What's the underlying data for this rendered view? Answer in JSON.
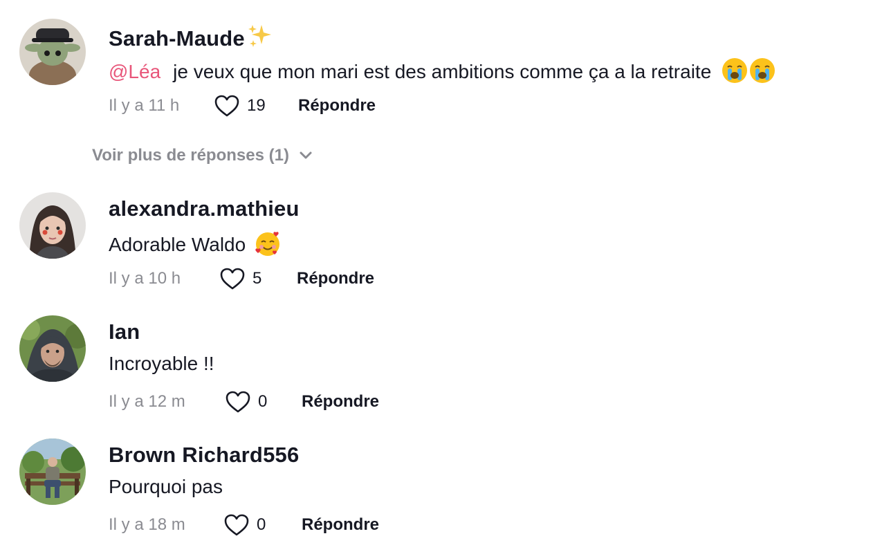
{
  "comments": [
    {
      "username": "Sarah-Maude",
      "username_emoji": "sparkles-emoji",
      "mention": "@Léa",
      "text": "je veux que mon mari est des ambitions comme ça a la retraite",
      "text_emojis": [
        "loudly-crying-face-emoji",
        "loudly-crying-face-emoji"
      ],
      "time": "Il y a 11 h",
      "likes": "19",
      "reply_label": "Répondre"
    },
    {
      "username": "alexandra.mathieu",
      "text": "Adorable Waldo",
      "text_emojis": [
        "smiling-face-with-hearts-emoji"
      ],
      "time": "Il y a 10 h",
      "likes": "5",
      "reply_label": "Répondre"
    },
    {
      "username": "Ian",
      "text": "Incroyable !!",
      "time": "Il y a 12 m",
      "likes": "0",
      "reply_label": "Répondre"
    },
    {
      "username": "Brown Richard556",
      "text": "Pourquoi pas",
      "time": "Il y a 18 m",
      "likes": "0",
      "reply_label": "Répondre"
    }
  ],
  "view_more_replies": "Voir plus de réponses (1)",
  "icons": {
    "like": "heart-outline-icon",
    "expand": "chevron-down-icon"
  },
  "colors": {
    "mention": "#e8567a",
    "secondary_text": "#8a8b91",
    "primary_text": "#161823"
  }
}
